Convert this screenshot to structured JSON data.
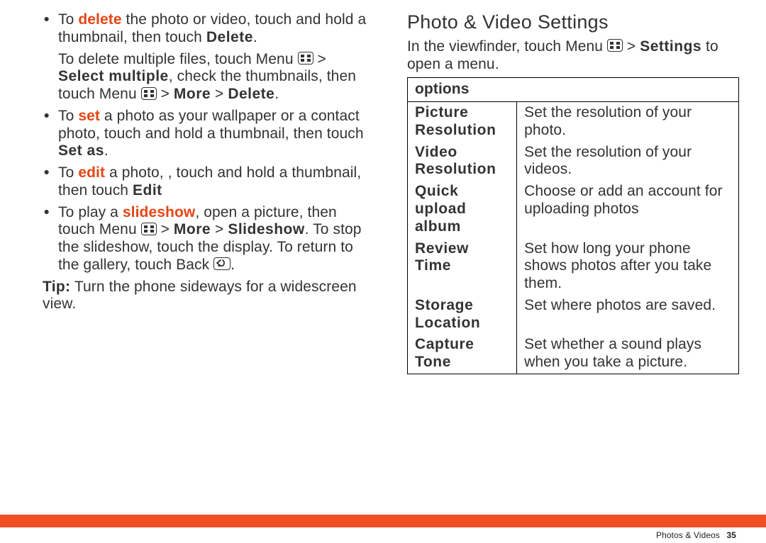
{
  "left": {
    "bullet1": {
      "pre": "To ",
      "kw": "delete",
      "post": " the photo or video, touch and hold a thumbnail, then touch ",
      "cmd": "Delete",
      "end": "."
    },
    "sub1": {
      "a": "To delete multiple files, touch Menu ",
      "b": " > ",
      "c": "Select multiple",
      "d": ", check the thumbnails, then touch Menu ",
      "e": " > ",
      "f": "More",
      "g": " > ",
      "h": "Delete",
      "i": "."
    },
    "bullet2": {
      "pre": "To ",
      "kw": "set",
      "post": " a photo as your wallpaper or a contact photo, touch and hold a thumbnail, then touch ",
      "cmd": "Set as",
      "end": "."
    },
    "bullet3": {
      "pre": "To ",
      "kw": "edit",
      "post": " a photo, , touch and hold a thumbnail, then touch ",
      "cmd": "Edit"
    },
    "bullet4": {
      "a": "To play a ",
      "kw": "slideshow",
      "b": ", open a picture, then touch Menu ",
      "c": " > ",
      "d": "More",
      "e": " > ",
      "f": "Slideshow",
      "g": ". To stop the slideshow, touch the display. To return to the gallery, touch Back ",
      "h": "."
    },
    "tip": {
      "label": "Tip:",
      "text": " Turn the phone sideways for a widescreen view."
    }
  },
  "right": {
    "heading": "Photo & Video Settings",
    "intro": {
      "a": "In the viewfinder, touch Menu ",
      "b": " > ",
      "c": "Settings",
      "d": " to open a menu."
    },
    "tableHeader": "options",
    "rows": [
      {
        "name": "Picture Resolution",
        "desc": "Set the resolution of your photo."
      },
      {
        "name": "Video Resolution",
        "desc": "Set the resolution of your videos."
      },
      {
        "name": "Quick upload album",
        "desc": "Choose or add an account for uploading photos"
      },
      {
        "name": "Review Time",
        "desc": "Set how long your phone shows photos after you take them."
      },
      {
        "name": "Storage Location",
        "desc": "Set where photos are saved."
      },
      {
        "name": "Capture Tone",
        "desc": "Set whether a sound plays when you take a picture."
      }
    ]
  },
  "footer": {
    "section": "Photos & Videos",
    "page": "35"
  }
}
